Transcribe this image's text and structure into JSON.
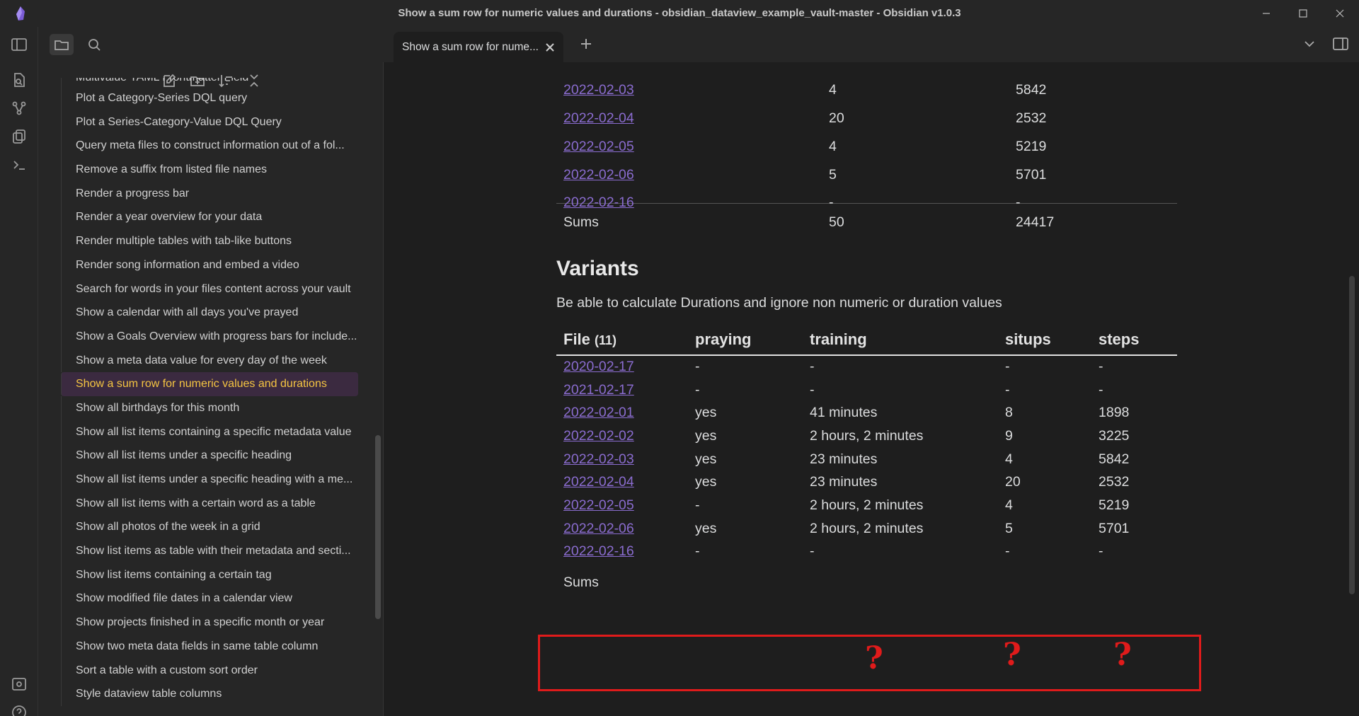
{
  "window": {
    "title": "Show a sum row for numeric values and durations - obsidian_dataview_example_vault-master - Obsidian v1.0.3"
  },
  "tab": {
    "title": "Show a sum row for nume..."
  },
  "file_explorer": {
    "partial_top": "Multivalue YAML Frontmatter Field",
    "items": [
      "Plot a Category-Series DQL query",
      "Plot a Series-Category-Value DQL Query",
      "Query meta files to construct information out of a fol...",
      "Remove a suffix from listed file names",
      "Render a progress bar",
      "Render a year overview for your data",
      "Render multiple tables with tab-like buttons",
      "Render song information and embed a video",
      "Search for words in your files content across your vault",
      "Show a calendar with all days you've prayed",
      "Show a Goals Overview with progress bars for include...",
      "Show a meta data value for every day of the week",
      "Show a sum row for numeric values and durations",
      "Show all birthdays for this month",
      "Show all list items containing a specific metadata value",
      "Show all list items under a specific heading",
      "Show all list items under a specific heading with a me...",
      "Show all list items with a certain word as a table",
      "Show all photos of the week in a grid",
      "Show list items as table with their metadata and secti...",
      "Show list items containing a certain tag",
      "Show modified file dates in a calendar view",
      "Show projects finished in a specific month or year",
      "Show two meta data fields in same table column",
      "Sort a table with a custom sort order",
      "Style dataview table columns"
    ],
    "active_index": 12
  },
  "table1": {
    "rows": [
      [
        "2022-02-03",
        "4",
        "5842"
      ],
      [
        "2022-02-04",
        "20",
        "2532"
      ],
      [
        "2022-02-05",
        "4",
        "5219"
      ],
      [
        "2022-02-06",
        "5",
        "5701"
      ],
      [
        "2022-02-16",
        "-",
        "-"
      ]
    ],
    "sum": [
      "Sums",
      "50",
      "24417"
    ]
  },
  "variants": {
    "heading": "Variants",
    "description": "Be able to calculate Durations and ignore non numeric or duration values",
    "headers": {
      "file": "File",
      "file_count": "(11)",
      "praying": "praying",
      "training": "training",
      "situps": "situps",
      "steps": "steps"
    },
    "rows": [
      [
        "2020-02-17",
        "-",
        "-",
        "-",
        "-"
      ],
      [
        "2021-02-17",
        "-",
        "-",
        "-",
        "-"
      ],
      [
        "2022-02-01",
        "yes",
        "41 minutes",
        "8",
        "1898"
      ],
      [
        "2022-02-02",
        "yes",
        "2 hours, 2 minutes",
        "9",
        "3225"
      ],
      [
        "2022-02-03",
        "yes",
        "23 minutes",
        "4",
        "5842"
      ],
      [
        "2022-02-04",
        "yes",
        "23 minutes",
        "20",
        "2532"
      ],
      [
        "2022-02-05",
        "-",
        "2 hours, 2 minutes",
        "4",
        "5219"
      ],
      [
        "2022-02-06",
        "yes",
        "2 hours, 2 minutes",
        "5",
        "5701"
      ],
      [
        "2022-02-16",
        "-",
        "-",
        "-",
        "-"
      ]
    ],
    "sum_label": "Sums",
    "unknown_mark": "?"
  },
  "colors": {
    "link": "#8a6ccf",
    "highlight": "#e01b1b",
    "active_file": "#f5c542"
  }
}
